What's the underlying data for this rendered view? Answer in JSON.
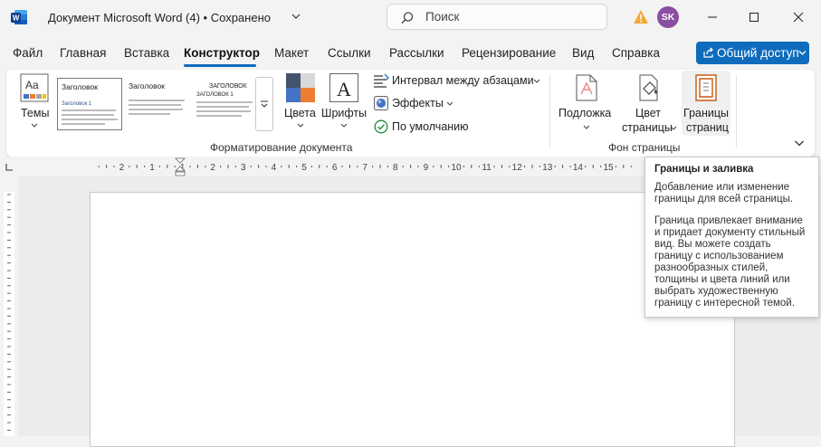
{
  "titlebar": {
    "title": "Документ Microsoft Word (4) • Сохранено",
    "search_placeholder": "Поиск",
    "avatar_initials": "SK"
  },
  "menu": {
    "items": [
      "Файл",
      "Главная",
      "Вставка",
      "Конструктор",
      "Макет",
      "Ссылки",
      "Рассылки",
      "Рецензирование",
      "Вид",
      "Справка"
    ],
    "active": "Конструктор",
    "share_label": "Общий доступ"
  },
  "ribbon": {
    "themes_label": "Темы",
    "style_thumbs": [
      {
        "heading": "Заголовок",
        "sub": "Заголовок 1"
      },
      {
        "heading": "Заголовок",
        "sub": ""
      },
      {
        "heading": "ЗАГОЛОВОК",
        "sub": "ЗАГОЛОВОК 1"
      }
    ],
    "colors_label": "Цвета",
    "fonts_label": "Шрифты",
    "spacing_label": "Интервал между абзацами",
    "effects_label": "Эффекты",
    "default_label": "По умолчанию",
    "group_doc_format": "Форматирование документа",
    "watermark_label": "Подложка",
    "page_color_label_1": "Цвет",
    "page_color_label_2": "страницы",
    "page_borders_label_1": "Границы",
    "page_borders_label_2": "страниц",
    "group_page_bg": "Фон страницы"
  },
  "ruler": {
    "labels": [
      "2",
      "1",
      "1",
      "2",
      "3",
      "4",
      "5",
      "6",
      "7",
      "8",
      "9",
      "10",
      "11",
      "12",
      "13",
      "14",
      "15"
    ]
  },
  "tooltip": {
    "title": "Границы и заливка",
    "p1": "Добавление или изменение границы для всей страницы.",
    "p2": "Граница привлекает внимание и придает документу стильный вид. Вы можете создать границу с использованием разнообразных стилей, толщины и цвета линий или выбрать художественную границу с интересной темой."
  },
  "colors": {
    "accent": "#0f6cbd",
    "avatar": "#8a4fa3",
    "warning": "#f2a93b"
  }
}
